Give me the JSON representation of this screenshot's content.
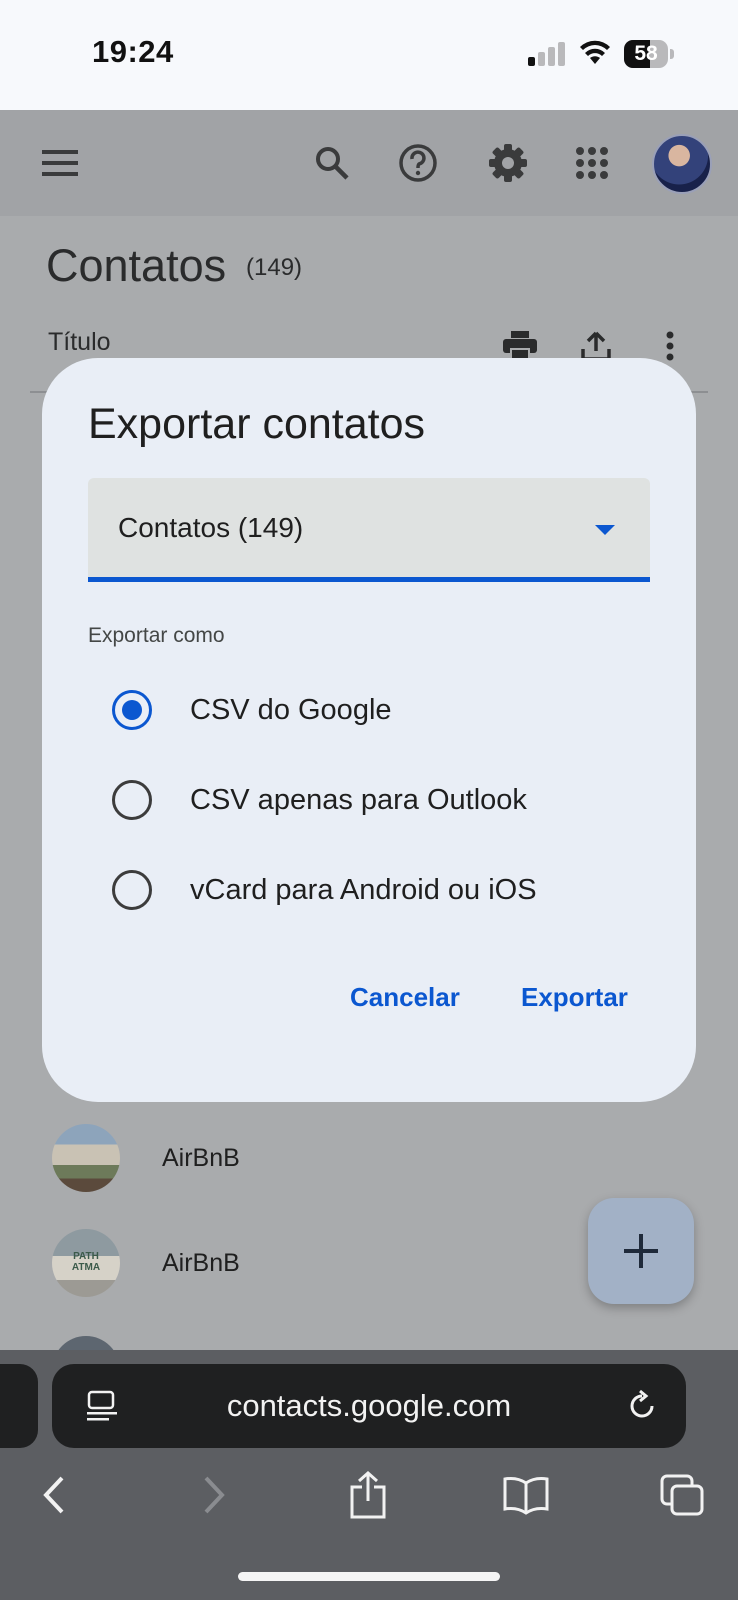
{
  "status_bar": {
    "time": "19:24",
    "battery": "58",
    "battery_level_pct": 58
  },
  "app_bar": {
    "icons": [
      "menu-icon",
      "search-icon",
      "help-icon",
      "settings-icon",
      "apps-icon",
      "account-avatar"
    ]
  },
  "page": {
    "title": "Contatos",
    "count": "(149)",
    "column_label": "Título",
    "toolbar_icons": [
      "print-icon",
      "export-icon",
      "more-vert-icon"
    ]
  },
  "contacts": [
    {
      "name": "AirBnB"
    },
    {
      "name": "AirBnB",
      "avatar_text": "PATH\nATMA"
    }
  ],
  "dialog": {
    "title": "Exportar contatos",
    "select_value": "Contatos (149)",
    "export_as_label": "Exportar como",
    "options": [
      {
        "label": "CSV do Google",
        "checked": true
      },
      {
        "label": "CSV apenas para Outlook",
        "checked": false
      },
      {
        "label": "vCard para Android ou iOS",
        "checked": false
      }
    ],
    "cancel_label": "Cancelar",
    "export_label": "Exportar"
  },
  "browser": {
    "url": "contacts.google.com",
    "icons": [
      "reader-icon",
      "reload-icon",
      "back-icon",
      "forward-icon",
      "share-icon",
      "bookmarks-icon",
      "tabs-icon"
    ]
  },
  "colors": {
    "accent": "#0b57d0",
    "dialog_bg": "#e9eef6",
    "scrim": "#a9abad"
  }
}
